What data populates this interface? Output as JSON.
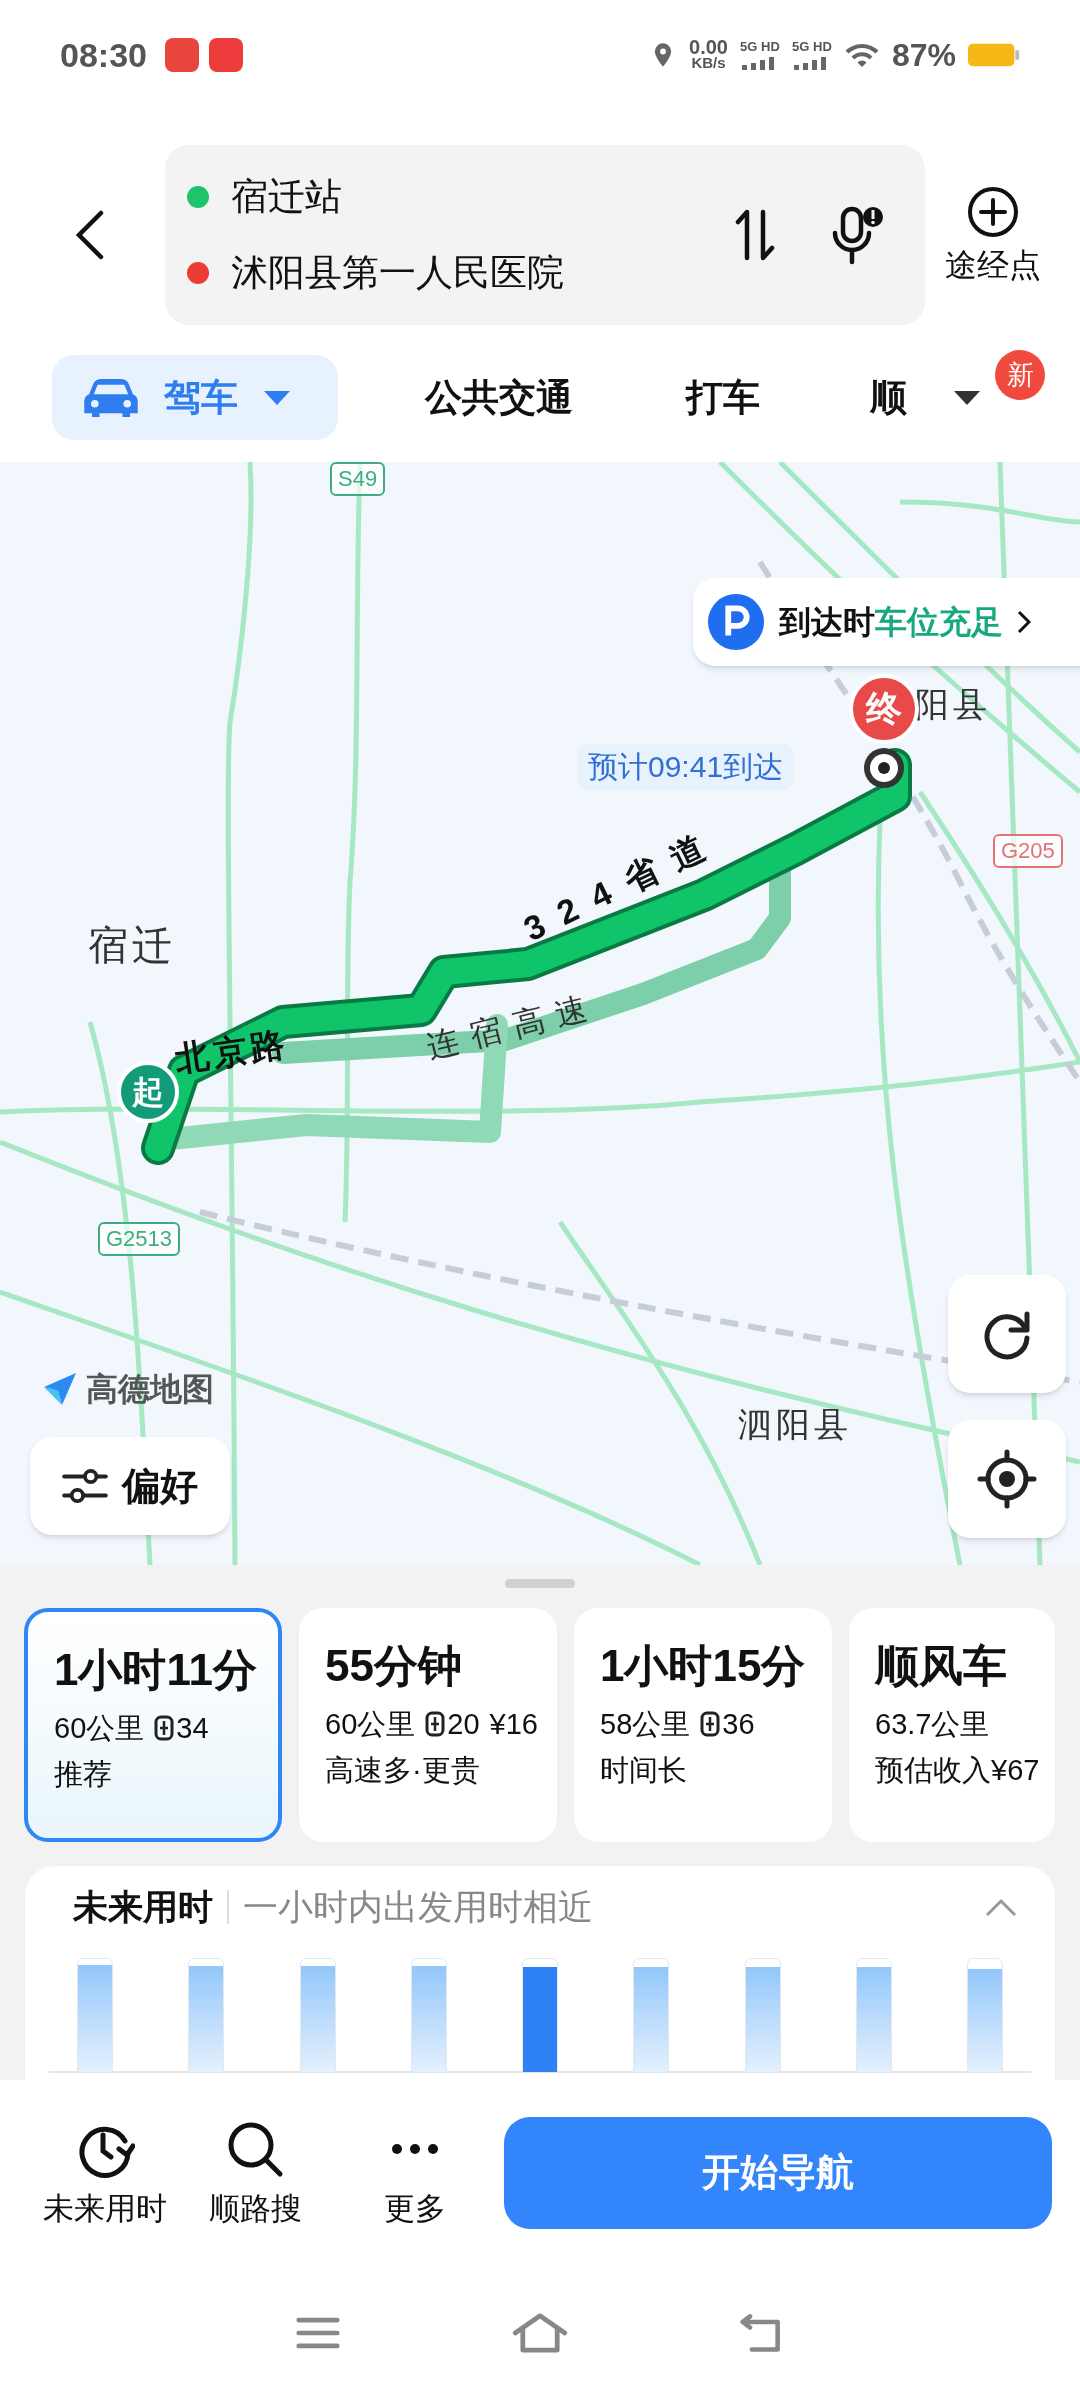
{
  "status_bar": {
    "time": "08:30",
    "net_speed": "0.00",
    "net_unit": "KB/s",
    "sim_labels": [
      "5G HD",
      "5G HD"
    ],
    "battery": "87%"
  },
  "route_input": {
    "origin": "宿迁站",
    "destination": "沭阳县第一人民医院",
    "waypoint_label": "途经点"
  },
  "modes": [
    {
      "label": "驾车",
      "selected": true
    },
    {
      "label": "公共交通",
      "selected": false
    },
    {
      "label": "打车",
      "selected": false
    },
    {
      "label": "顺",
      "selected": false
    }
  ],
  "modes_badge": "新",
  "map": {
    "shields": [
      {
        "text": "S49",
        "color": "#3fae7c"
      },
      {
        "text": "G205",
        "color": "#e57373"
      },
      {
        "text": "G2513",
        "color": "#3fae7c"
      }
    ],
    "places": [
      "宿迁",
      "阳县",
      "泗阳县"
    ],
    "roads": [
      "北京路",
      "连宿高速",
      "324省道"
    ],
    "eta": "预计09:41到达",
    "start_marker": "起",
    "end_marker": "终",
    "parking": {
      "prefix": "到达时",
      "status": "车位充足"
    },
    "logo": "高德地图",
    "preference_button": "偏好"
  },
  "routes": [
    {
      "time": "1小时11分",
      "distance": "60公里",
      "toll": "34",
      "note": "推荐",
      "selected": true
    },
    {
      "time": "55分钟",
      "distance": "60公里",
      "toll": "20",
      "cost": "¥16",
      "note": "高速多·更贵",
      "selected": false
    },
    {
      "time": "1小时15分",
      "distance": "58公里",
      "toll": "36",
      "note": "时间长",
      "selected": false
    },
    {
      "time": "顺风车",
      "distance": "63.7公里",
      "note": "预估收入¥67",
      "selected": false
    }
  ],
  "future": {
    "title": "未来用时",
    "subtitle": "一小时内出发用时相近",
    "expanded": true,
    "bars": [
      {
        "level": 0.95,
        "selected": false
      },
      {
        "level": 0.94,
        "selected": false
      },
      {
        "level": 0.94,
        "selected": false
      },
      {
        "level": 0.94,
        "selected": false
      },
      {
        "level": 0.93,
        "selected": true
      },
      {
        "level": 0.93,
        "selected": false
      },
      {
        "level": 0.93,
        "selected": false
      },
      {
        "level": 0.93,
        "selected": false
      },
      {
        "level": 0.91,
        "selected": false
      }
    ]
  },
  "actions": [
    {
      "label": "未来用时",
      "kind": "clock"
    },
    {
      "label": "顺路搜",
      "kind": "search"
    },
    {
      "label": "更多",
      "kind": "more"
    }
  ],
  "start_button": "开始导航"
}
